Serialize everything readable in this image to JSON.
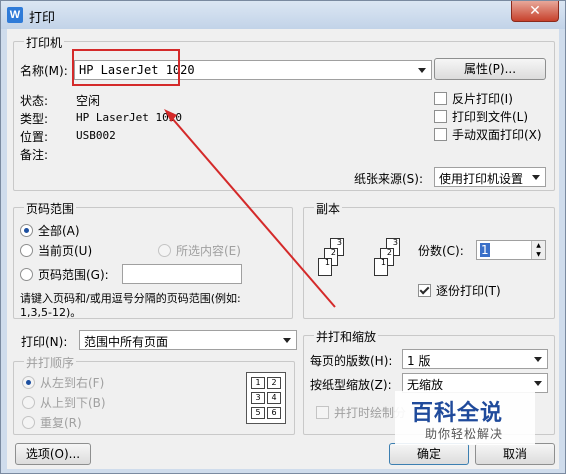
{
  "title": "打印",
  "close_glyph": "✕",
  "app_icon": "W",
  "printer": {
    "group_title": "打印机",
    "name_label": "名称(M):",
    "name_value": "HP LaserJet 1020",
    "properties_button": "属性(P)...",
    "status_label": "状态:",
    "status_value": "空闲",
    "type_label": "类型:",
    "type_value": "HP LaserJet 1020",
    "location_label": "位置:",
    "location_value": "USB002",
    "comment_label": "备注:",
    "reverse_print": "反片打印(I)",
    "print_to_file": "打印到文件(L)",
    "manual_duplex": "手动双面打印(X)",
    "paper_source_label": "纸张来源(S):",
    "paper_source_value": "使用打印机设置"
  },
  "page_range": {
    "group_title": "页码范围",
    "all": "全部(A)",
    "current": "当前页(U)",
    "selection": "所选内容(E)",
    "pages": "页码范围(G):",
    "pages_value": "",
    "hint_line1": "请键入页码和/或用逗号分隔的页码范围(例如:",
    "hint_line2": "1,3,5-12)。"
  },
  "copies": {
    "group_title": "副本",
    "count_label": "份数(C):",
    "count_value": "1",
    "collate": "逐份打印(T)"
  },
  "print_what": {
    "label": "打印(N):",
    "value": "范围中所有页面"
  },
  "order": {
    "group_title": "并打顺序",
    "left_to_right": "从左到右(F)",
    "top_to_bottom": "从上到下(B)",
    "repeat": "重复(R)",
    "grid": [
      "1",
      "2",
      "3",
      "4",
      "5",
      "6"
    ]
  },
  "scaling": {
    "group_title": "并打和缩放",
    "pages_per_sheet_label": "每页的版数(H):",
    "pages_per_sheet_value": "1 版",
    "scale_label": "按纸型缩放(Z):",
    "scale_value": "无缩放",
    "draw_borders": "并打时绘制分"
  },
  "buttons": {
    "options": "选项(O)...",
    "ok": "确定",
    "cancel": "取消"
  },
  "watermark": {
    "title": "百科全说",
    "subtitle": "助你轻松解决"
  },
  "annotation_color": "#d42a2a"
}
